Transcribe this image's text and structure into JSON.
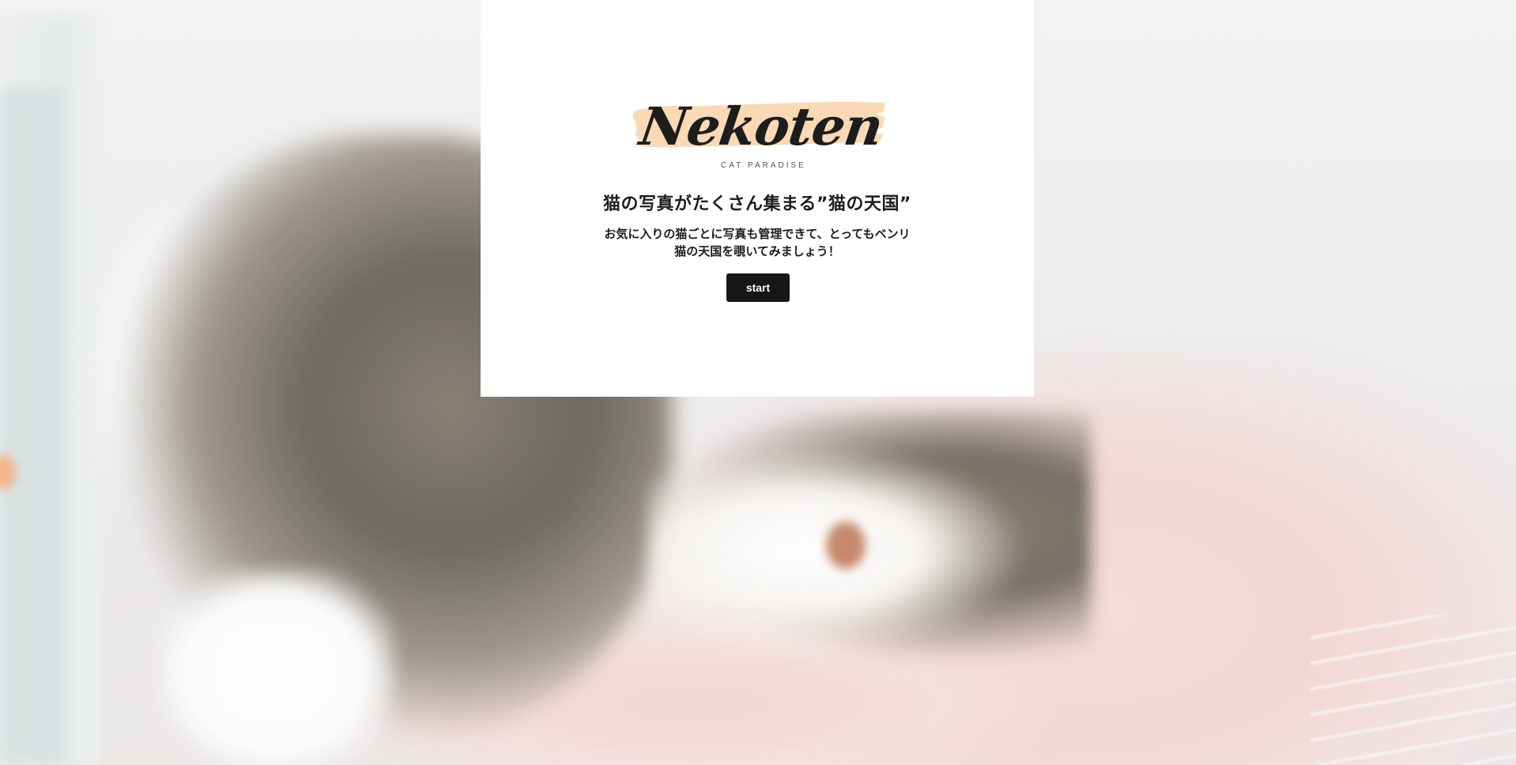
{
  "logo": {
    "wordmark": "Nekoten",
    "tagline": "CAT PARADISE",
    "brush_color": "#fad9b4"
  },
  "hero": {
    "headline": "猫の写真がたくさん集まる”猫の天国”",
    "description_line1": "お気に入りの猫ごとに写真も管理できて、とってもベンリ",
    "description_line2": "猫の天国を覗いてみましょう！"
  },
  "actions": {
    "start_label": "start"
  },
  "colors": {
    "button_bg": "#161616",
    "text": "#1d1d1d",
    "modal_bg": "#ffffff"
  },
  "background": {
    "icon": "cat-photo"
  }
}
